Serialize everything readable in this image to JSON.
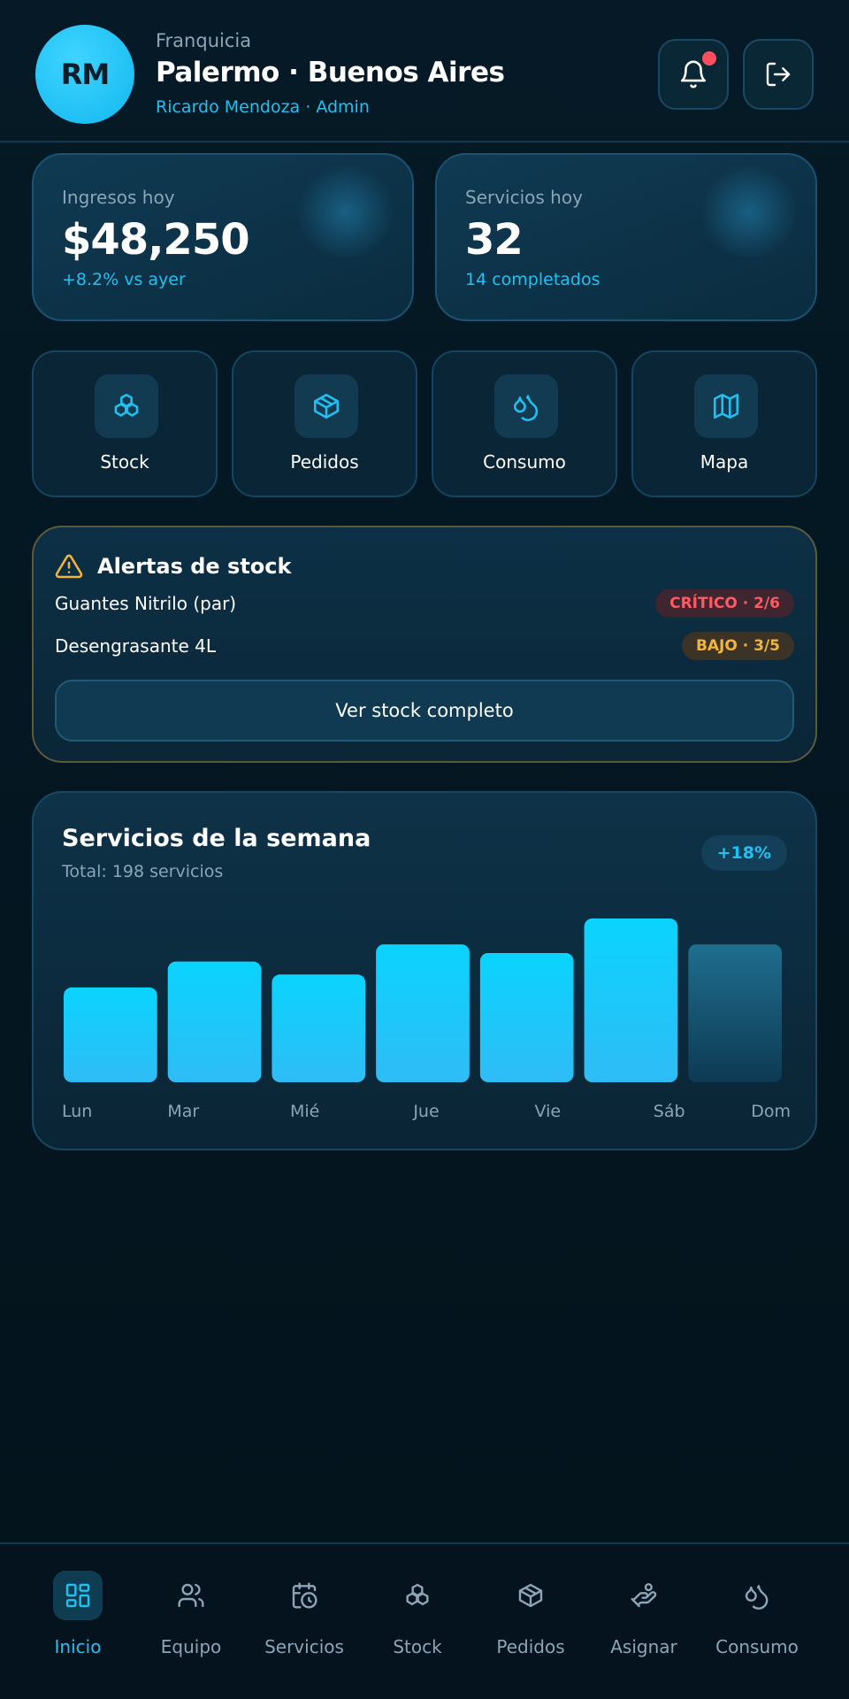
{
  "colors": {
    "accent": "#22c0f0",
    "critical": "#ff5a62",
    "warning": "#f2b43c",
    "background": "#03141e"
  },
  "header": {
    "avatar_initials": "RM",
    "kicker": "Franquicia",
    "title": "Palermo · Buenos Aires",
    "user": "Ricardo Mendoza · Admin",
    "notifications_icon": "bell-icon",
    "logout_icon": "logout-icon"
  },
  "stats": [
    {
      "label": "Ingresos hoy",
      "value": "$48,250",
      "sub": "+8.2% vs ayer"
    },
    {
      "label": "Servicios hoy",
      "value": "32",
      "sub": "14 completados"
    }
  ],
  "actions": [
    {
      "label": "Stock",
      "icon": "boxes-icon"
    },
    {
      "label": "Pedidos",
      "icon": "package-icon"
    },
    {
      "label": "Consumo",
      "icon": "droplets-icon"
    },
    {
      "label": "Mapa",
      "icon": "map-icon"
    }
  ],
  "alerts": {
    "title": "Alertas de stock",
    "items": [
      {
        "name": "Guantes Nitrilo (par)",
        "status": "CRÍTICO · 2/6",
        "level": "critical"
      },
      {
        "name": "Desengrasante 4L",
        "status": "BAJO · 3/5",
        "level": "low"
      }
    ],
    "button": "Ver stock completo"
  },
  "chart": {
    "title": "Servicios de la semana",
    "subtitle": "Total: 198 servicios",
    "badge": "+18%"
  },
  "chart_data": {
    "type": "bar",
    "categories": [
      "Lun",
      "Mar",
      "Mié",
      "Jue",
      "Vie",
      "Sáb",
      "Dom"
    ],
    "values": [
      22,
      28,
      25,
      32,
      30,
      38,
      32
    ],
    "ylim": [
      0,
      38
    ],
    "highlight_last": true,
    "grid": false
  },
  "nav": [
    {
      "label": "Inicio",
      "icon": "grid-icon",
      "active": true
    },
    {
      "label": "Equipo",
      "icon": "users-icon",
      "active": false
    },
    {
      "label": "Servicios",
      "icon": "calendar-clock-icon",
      "active": false
    },
    {
      "label": "Stock",
      "icon": "boxes-icon",
      "active": false
    },
    {
      "label": "Pedidos",
      "icon": "package-icon",
      "active": false
    },
    {
      "label": "Asignar",
      "icon": "hand-assign-icon",
      "active": false
    },
    {
      "label": "Consumo",
      "icon": "droplets-icon",
      "active": false
    }
  ]
}
